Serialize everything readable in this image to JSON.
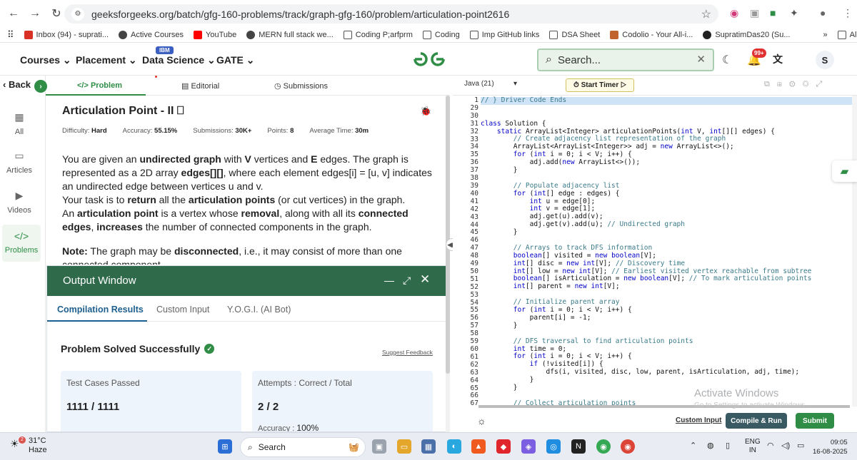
{
  "browser": {
    "url": "geeksforgeeks.org/batch/gfg-160-problems/track/graph-gfg-160/problem/articulation-point2616",
    "bookmarks": [
      "Inbox (94) - suprati...",
      "Active Courses",
      "YouTube",
      "MERN full stack we...",
      "Coding P;arfprm",
      "Coding",
      "Imp GitHub links",
      "DSA Sheet",
      "Codolio - Your All-i...",
      "SupratimDas20 (Su..."
    ],
    "all_bookmarks": "All Bookmarks"
  },
  "header": {
    "nav": [
      "Courses",
      "Placement",
      "Data Science",
      "GATE"
    ],
    "ibm_badge": "IBM",
    "logo": "GfG",
    "search_placeholder": "Search...",
    "notif_badge": "99+",
    "avatar": "S"
  },
  "rail": {
    "back": "Back",
    "items": [
      "All",
      "Articles",
      "Videos",
      "Problems"
    ]
  },
  "tabs": [
    "Problem",
    "Editorial",
    "Submissions"
  ],
  "problem": {
    "title": "Articulation Point - II",
    "difficulty_label": "Difficulty:",
    "difficulty": "Hard",
    "accuracy_label": "Accuracy:",
    "accuracy": "55.15%",
    "submissions_label": "Submissions:",
    "submissions": "30K+",
    "points_label": "Points:",
    "points": "8",
    "avg_label": "Average Time:",
    "avg_time": "30m",
    "description_html": "You are given an <b>undirected graph</b> with <b>V</b> vertices and <b>E</b> edges. The graph is represented as a 2D array <b>edges[][]</b>, where each element edges[i] = [u, v] indicates an undirected edge between vertices u and v.<br>Your task is to <b>return</b> all the <b>articulation points</b> (or cut vertices) in the graph.<br>An <b>articulation point</b> is a vertex whose <b>removal</b>, along with all its <b>connected edges</b>, <b>increases</b> the number of connected components in the graph.",
    "note_html": "<b>Note:</b> The graph may be <b>disconnected</b>, i.e., it may consist of more than one connected component."
  },
  "output": {
    "title": "Output Window",
    "tabs": [
      "Compilation Results",
      "Custom Input",
      "Y.O.G.I. (AI Bot)"
    ],
    "status": "Problem Solved Successfully",
    "suggest": "Suggest Feedback",
    "tests_label": "Test Cases Passed",
    "tests_value": "1111 / 1111",
    "attempts_label": "Attempts : Correct / Total",
    "attempts_value": "2 / 2",
    "accuracy_label": "Accuracy :",
    "accuracy_value": "100%"
  },
  "editor": {
    "language": "Java (21)",
    "timer": "Start Timer",
    "line_numbers": [
      "1",
      "29",
      "30",
      "31",
      "32",
      "33",
      "34",
      "35",
      "36",
      "37",
      "38",
      "39",
      "40",
      "41",
      "42",
      "43",
      "44",
      "45",
      "46",
      "47",
      "48",
      "49",
      "50",
      "51",
      "52",
      "53",
      "54",
      "55",
      "56",
      "57",
      "58",
      "59",
      "60",
      "61",
      "62",
      "63",
      "64",
      "65",
      "66",
      "67"
    ],
    "code_html": [
      "<span class=\"cm\">// } Driver Code Ends</span>",
      "",
      "",
      "<span class=\"kw\">class</span> Solution {",
      "    <span class=\"kw\">static</span> ArrayList&lt;Integer&gt; articulationPoints(<span class=\"kw\">int</span> V, <span class=\"kw\">int</span>[][] edges) {",
      "        <span class=\"cm\">// Create adjacency list representation of the graph</span>",
      "        ArrayList&lt;ArrayList&lt;Integer&gt;&gt; adj = <span class=\"kw\">new</span> ArrayList&lt;&gt;();",
      "        <span class=\"kw\">for</span> (<span class=\"kw\">int</span> i = 0; i &lt; V; i++) {",
      "            adj.add(<span class=\"kw\">new</span> ArrayList&lt;&gt;());",
      "        }",
      "",
      "        <span class=\"cm\">// Populate adjacency list</span>",
      "        <span class=\"kw\">for</span> (<span class=\"kw\">int</span>[] edge : edges) {",
      "            <span class=\"kw\">int</span> u = edge[0];",
      "            <span class=\"kw\">int</span> v = edge[1];",
      "            adj.get(u).add(v);",
      "            adj.get(v).add(u); <span class=\"cm\">// Undirected graph</span>",
      "        }",
      "",
      "        <span class=\"cm\">// Arrays to track DFS information</span>",
      "        <span class=\"kw\">boolean</span>[] visited = <span class=\"kw\">new</span> <span class=\"kw\">boolean</span>[V];",
      "        <span class=\"kw\">int</span>[] disc = <span class=\"kw\">new</span> <span class=\"kw\">int</span>[V]; <span class=\"cm\">// Discovery time</span>",
      "        <span class=\"kw\">int</span>[] low = <span class=\"kw\">new</span> <span class=\"kw\">int</span>[V]; <span class=\"cm\">// Earliest visited vertex reachable from subtree</span>",
      "        <span class=\"kw\">boolean</span>[] isArticulation = <span class=\"kw\">new</span> <span class=\"kw\">boolean</span>[V]; <span class=\"cm\">// To mark articulation points</span>",
      "        <span class=\"kw\">int</span>[] parent = <span class=\"kw\">new</span> <span class=\"kw\">int</span>[V];",
      "",
      "        <span class=\"cm\">// Initialize parent array</span>",
      "        <span class=\"kw\">for</span> (<span class=\"kw\">int</span> i = 0; i &lt; V; i++) {",
      "            parent[i] = -1;",
      "        }",
      "",
      "        <span class=\"cm\">// DFS traversal to find articulation points</span>",
      "        <span class=\"kw\">int</span> time = 0;",
      "        <span class=\"kw\">for</span> (<span class=\"kw\">int</span> i = 0; i &lt; V; i++) {",
      "            <span class=\"kw\">if</span> (!visited[i]) {",
      "                dfs(i, visited, disc, low, parent, isArticulation, adj, time);",
      "            }",
      "        }",
      "",
      "        <span class=\"cm\">// Collect articulation points</span>"
    ],
    "activate": "Activate Windows",
    "activate_sub": "Go to Settings to activate Windows.",
    "custom_input": "Custom Input",
    "compile_run": "Compile & Run",
    "submit": "Submit"
  },
  "taskbar": {
    "temp": "31°C",
    "weather": "Haze",
    "weather_badge": "2",
    "search": "Search",
    "lang1": "ENG",
    "lang2": "IN",
    "time": "09:05",
    "date": "16-08-2025"
  },
  "colors": {
    "brand_green": "#2f8d46",
    "output_header": "#2f6a4a",
    "link_blue": "#1d5f8f"
  }
}
